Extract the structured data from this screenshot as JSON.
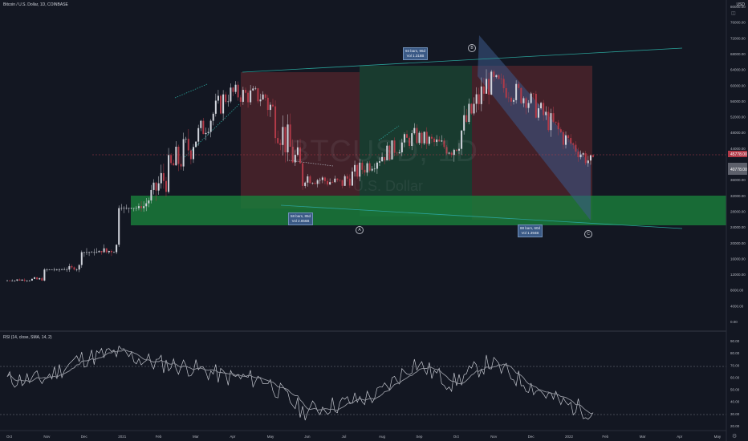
{
  "header": {
    "symbol_line": "Bitcoin / U.S. Dollar, 1D, COINBASE",
    "currency": "USD"
  },
  "watermark": {
    "ticker": "BTCUSD, 1D",
    "name": "U.S. Dollar"
  },
  "colors": {
    "bg": "#131722",
    "up": "#d1d4dc",
    "down": "#b23a48",
    "green_zone": "#1a7a3a",
    "red_zone": "#7a2a2a",
    "channel": "#3d5a8a",
    "rsi": "#c3c6ce",
    "trend": "#2aa198"
  },
  "annotations": {
    "note_top": {
      "line1": "93 bars, 96d",
      "line2": "Vol 1.318B"
    },
    "note_left": {
      "line1": "58 bars, 85d",
      "line2": "Vol 2.856B"
    },
    "note_right": {
      "line1": "88 bars, 60d",
      "line2": "Vol 1.394B"
    },
    "wave_a": "A",
    "wave_b": "B",
    "wave_c": "C"
  },
  "rsi": {
    "label": "RSI (14, close, SMA, 14, 2)"
  },
  "chart_data": [
    {
      "type": "candlestick",
      "title": "Bitcoin / U.S. Dollar, 1D, COINBASE",
      "x_ticks": [
        "Oct",
        "Nov",
        "Dec",
        "2021",
        "Feb",
        "Mar",
        "Apr",
        "May",
        "Jun",
        "Jul",
        "Aug",
        "Sep",
        "Oct",
        "Nov",
        "Dec",
        "2022",
        "Feb",
        "Mar",
        "Apr",
        "May"
      ],
      "y_ticks": [
        "80000.00",
        "76000.00",
        "72000.00",
        "68000.00",
        "64000.00",
        "60000.00",
        "56000.00",
        "52000.00",
        "48000.00",
        "44000.00",
        "40000.00",
        "36000.00",
        "32000.00",
        "28000.00",
        "24000.00",
        "20000.00",
        "16000.00",
        "12000.00",
        "8000.00",
        "4000.00",
        "0.00"
      ],
      "price_labels": {
        "current": "40778.00",
        "marker": "45778.00"
      },
      "months": [
        "Oct",
        "Nov",
        "Dec",
        "Jan",
        "Feb",
        "Mar",
        "Apr",
        "May",
        "Jun",
        "Jul",
        "Aug",
        "Sep",
        "Oct",
        "Nov",
        "Dec",
        "Jan"
      ],
      "approx_close": [
        10700,
        13800,
        19000,
        33000,
        45000,
        58000,
        57000,
        37000,
        35000,
        41500,
        47000,
        43800,
        61000,
        57000,
        47000,
        38000
      ],
      "approx_high": [
        13800,
        19800,
        29000,
        42000,
        58000,
        61800,
        64800,
        59000,
        41300,
        42400,
        50500,
        52900,
        67000,
        69000,
        59000,
        48000
      ],
      "approx_low": [
        10400,
        13200,
        17600,
        28800,
        32000,
        44000,
        50500,
        30000,
        31000,
        29300,
        37500,
        40000,
        43000,
        53000,
        42000,
        36000
      ],
      "ylim": [
        0,
        80000
      ]
    },
    {
      "type": "line",
      "title": "RSI (14, close, SMA, 14, 2)",
      "y_ticks": [
        "90.00",
        "80.00",
        "70.00",
        "60.00",
        "50.00",
        "40.00",
        "30.00",
        "20.00"
      ],
      "levels": [
        70,
        30
      ],
      "ylim": [
        20,
        90
      ],
      "approx_rsi_by_month": [
        58,
        75,
        80,
        72,
        68,
        60,
        58,
        32,
        38,
        45,
        72,
        55,
        72,
        55,
        38,
        30
      ]
    }
  ]
}
